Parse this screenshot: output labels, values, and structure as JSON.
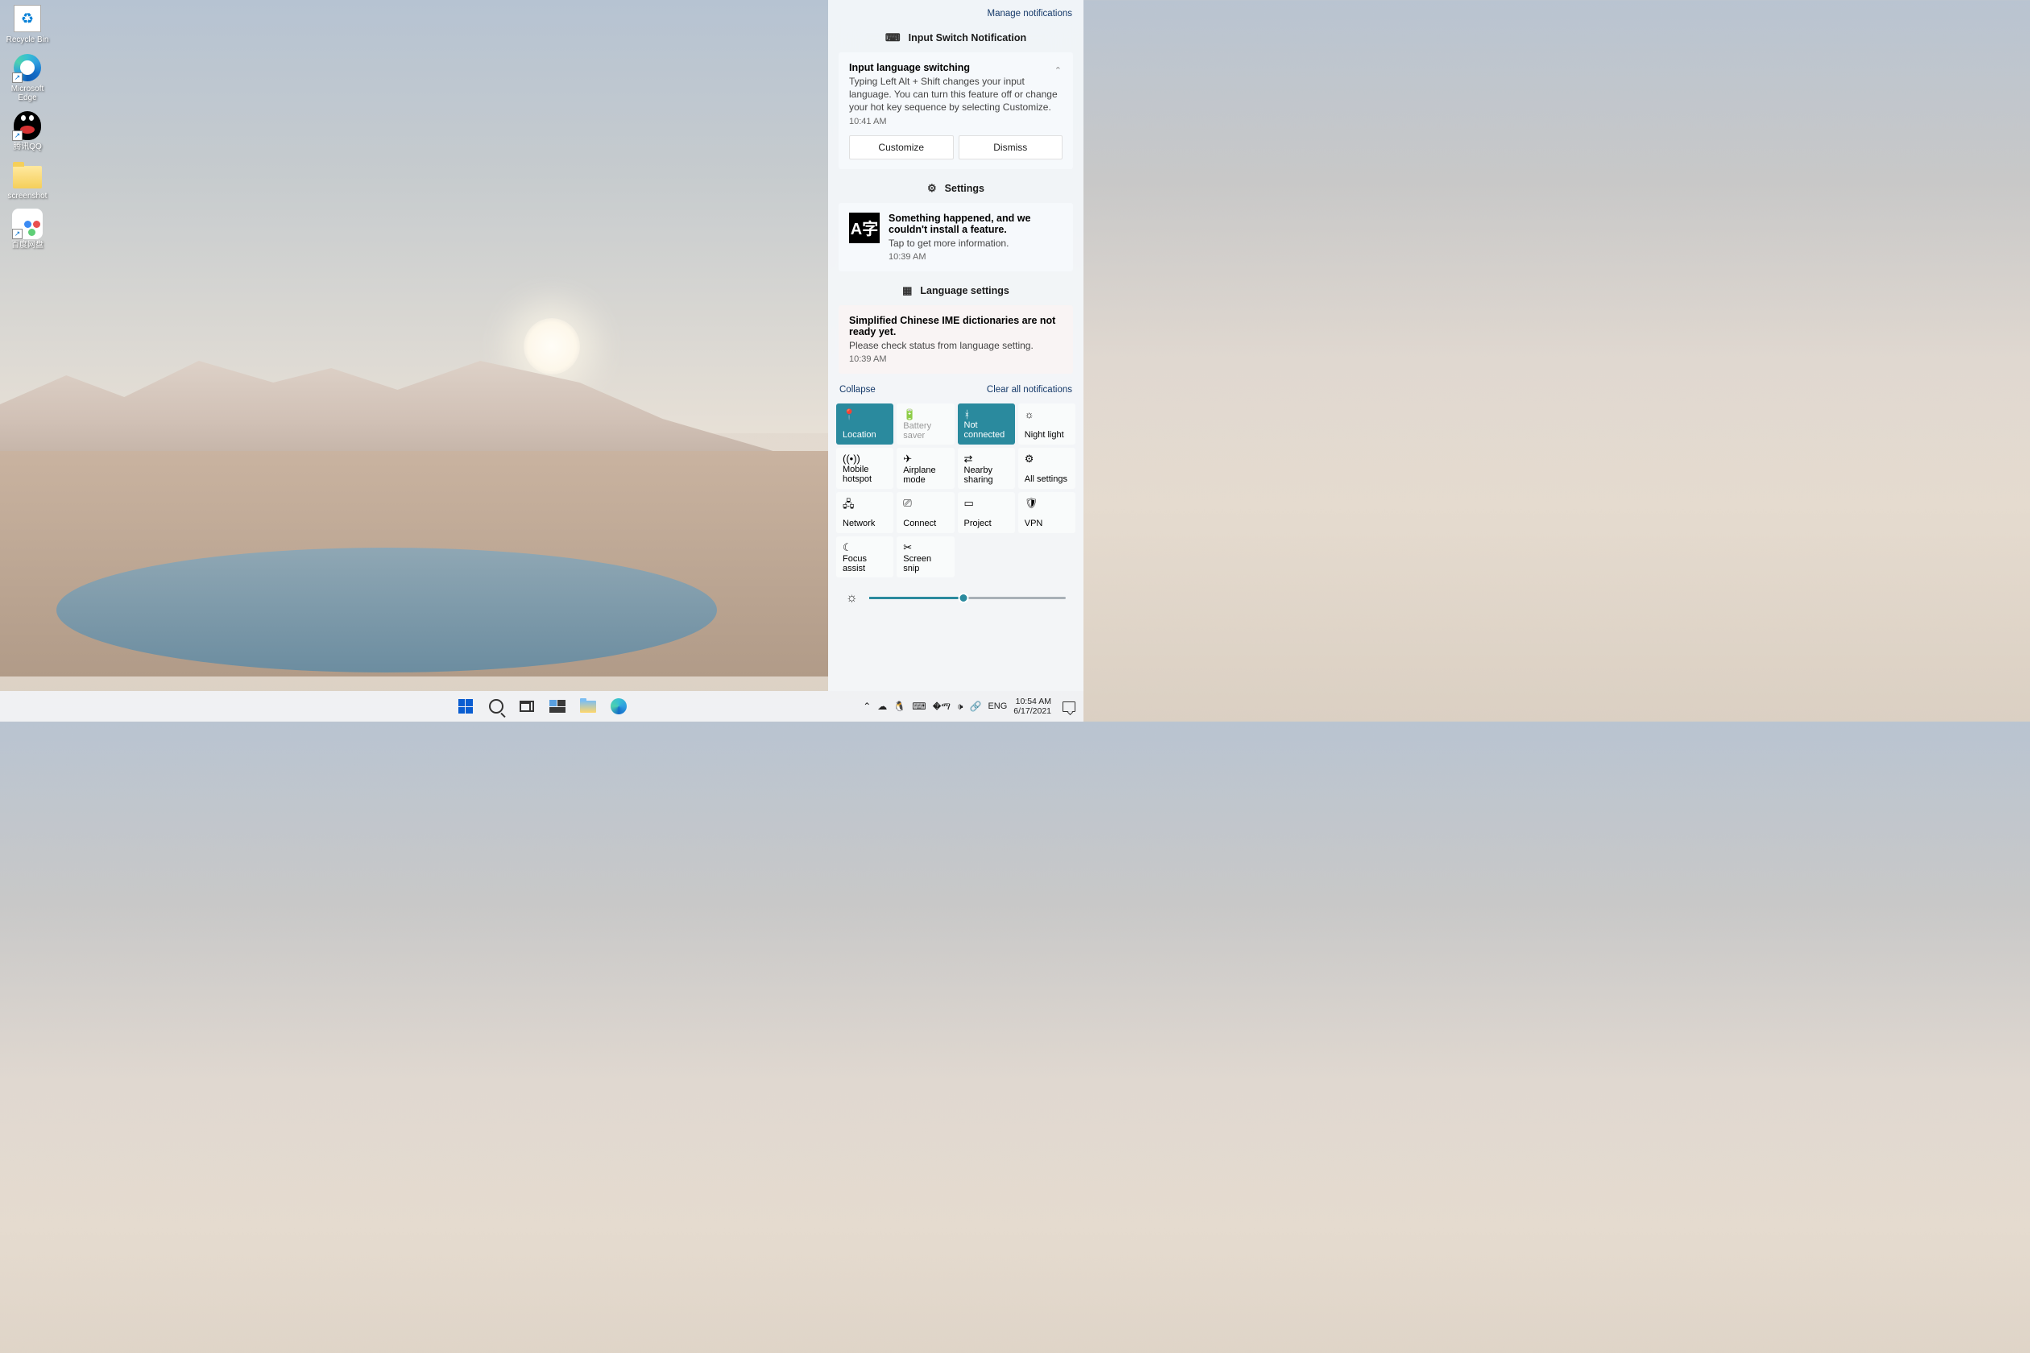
{
  "desktop_icons": [
    {
      "name": "recycle-bin",
      "label": "Recycle Bin"
    },
    {
      "name": "edge",
      "label": "Microsoft Edge",
      "shortcut": true
    },
    {
      "name": "qq",
      "label": "腾讯QQ",
      "shortcut": true
    },
    {
      "name": "screenshot-folder",
      "label": "screenshot"
    },
    {
      "name": "baidu-netdisk",
      "label": "百度网盘",
      "shortcut": true
    }
  ],
  "notification_panel": {
    "manage_label": "Manage notifications",
    "groups": [
      {
        "app_icon": "keyboard-icon",
        "app_name": "Input Switch Notification",
        "card": {
          "title": "Input language switching",
          "body": "Typing Left Alt + Shift changes your input language. You can turn this feature off or change your hot key sequence by selecting Customize.",
          "time": "10:41 AM",
          "actions": [
            "Customize",
            "Dismiss"
          ],
          "collapsible": true
        }
      },
      {
        "app_icon": "gear-icon",
        "app_name": "Settings",
        "card": {
          "icon": "A字",
          "title": "Something happened, and we couldn't install a feature.",
          "body": "Tap to get more information.",
          "time": "10:39 AM"
        }
      },
      {
        "app_icon": "language-icon",
        "app_name": "Language settings",
        "card": {
          "title": "Simplified Chinese IME dictionaries are not ready yet.",
          "body": "Please check status from language setting.",
          "time": "10:39 AM",
          "pink": true
        }
      }
    ],
    "footer": {
      "collapse": "Collapse",
      "clear": "Clear all notifications"
    },
    "quick_actions": [
      {
        "icon": "📍",
        "label": "Location",
        "active": true,
        "name": "location"
      },
      {
        "icon": "🔋",
        "label": "Battery saver",
        "dim": true,
        "name": "battery-saver"
      },
      {
        "icon": "ᚼ",
        "label": "Not connected",
        "active": true,
        "name": "bluetooth"
      },
      {
        "icon": "☼",
        "label": "Night light",
        "name": "night-light"
      },
      {
        "icon": "((•))",
        "label": "Mobile hotspot",
        "name": "mobile-hotspot"
      },
      {
        "icon": "✈",
        "label": "Airplane mode",
        "name": "airplane-mode"
      },
      {
        "icon": "⇄",
        "label": "Nearby sharing",
        "name": "nearby-sharing"
      },
      {
        "icon": "⚙",
        "label": "All settings",
        "name": "all-settings"
      },
      {
        "icon": "🖧",
        "label": "Network",
        "name": "network"
      },
      {
        "icon": "⎚",
        "label": "Connect",
        "name": "connect"
      },
      {
        "icon": "▭",
        "label": "Project",
        "name": "project"
      },
      {
        "icon": "🛡",
        "label": "VPN",
        "name": "vpn"
      },
      {
        "icon": "☾",
        "label": "Focus assist",
        "name": "focus-assist"
      },
      {
        "icon": "✂",
        "label": "Screen snip",
        "name": "screen-snip"
      }
    ],
    "brightness_pct": 48
  },
  "taskbar": {
    "center": [
      "start",
      "search",
      "task-view",
      "widgets",
      "file-explorer",
      "edge"
    ],
    "tray": {
      "chevron": "⌃",
      "icons": [
        "onedrive",
        "qq-tray",
        "input-mode",
        "wifi",
        "volume",
        "link"
      ],
      "lang": "ENG",
      "time": "10:54 AM",
      "date": "6/17/2021"
    }
  }
}
